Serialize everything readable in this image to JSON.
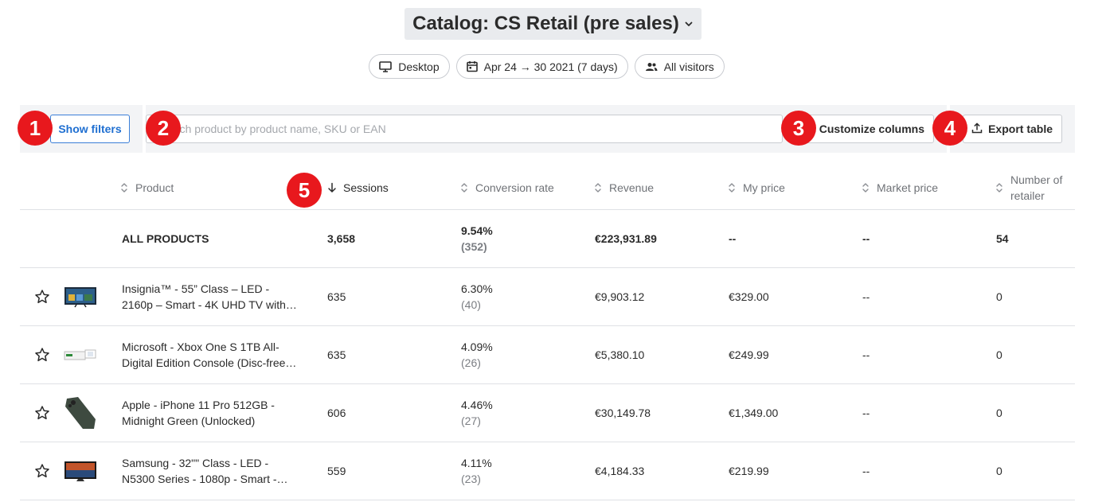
{
  "header": {
    "title": "Catalog: CS Retail (pre sales)"
  },
  "filters_bar": {
    "device": "Desktop",
    "date_range": "Apr 24 → 30 2021 (7 days)",
    "audience": "All visitors"
  },
  "toolbar": {
    "show_filters": "Show filters",
    "search_placeholder": "Search product by product name, SKU or EAN",
    "customize_columns": "Customize columns",
    "export_table": "Export table"
  },
  "annotations": [
    "1",
    "2",
    "3",
    "4",
    "5"
  ],
  "table": {
    "columns": {
      "product": "Product",
      "sessions": "Sessions",
      "conversion_rate": "Conversion rate",
      "revenue": "Revenue",
      "my_price": "My price",
      "market_price": "Market price",
      "retailers_line1": "Number of",
      "retailers_line2": "retailer"
    },
    "summary": {
      "product": "ALL PRODUCTS",
      "sessions": "3,658",
      "conversion_rate": "9.54%",
      "conversions": "(352)",
      "revenue": "€223,931.89",
      "my_price": "--",
      "market_price": "--",
      "retailers": "54"
    },
    "rows": [
      {
        "name_line1": "Insignia™ - 55” Class – LED -",
        "name_line2": "2160p – Smart - 4K UHD TV with…",
        "sessions": "635",
        "conversion_rate": "6.30%",
        "conversions": "(40)",
        "revenue": "€9,903.12",
        "my_price": "€329.00",
        "market_price": "--",
        "retailers": "0"
      },
      {
        "name_line1": "Microsoft - Xbox One S 1TB All-",
        "name_line2": "Digital Edition Console (Disc-free…",
        "sessions": "635",
        "conversion_rate": "4.09%",
        "conversions": "(26)",
        "revenue": "€5,380.10",
        "my_price": "€249.99",
        "market_price": "--",
        "retailers": "0"
      },
      {
        "name_line1": "Apple - iPhone 11 Pro 512GB -",
        "name_line2": "Midnight Green (Unlocked)",
        "sessions": "606",
        "conversion_rate": "4.46%",
        "conversions": "(27)",
        "revenue": "€30,149.78",
        "my_price": "€1,349.00",
        "market_price": "--",
        "retailers": "0"
      },
      {
        "name_line1": "Samsung - 32\"\" Class - LED -",
        "name_line2": "N5300 Series - 1080p - Smart -…",
        "sessions": "559",
        "conversion_rate": "4.11%",
        "conversions": "(23)",
        "revenue": "€4,184.33",
        "my_price": "€219.99",
        "market_price": "--",
        "retailers": "0"
      }
    ]
  },
  "colors": {
    "accent": "#1f6fd1",
    "badge": "#e8181d",
    "toolbar_bg": "#f3f4f6",
    "title_bg": "#e9ebee"
  }
}
